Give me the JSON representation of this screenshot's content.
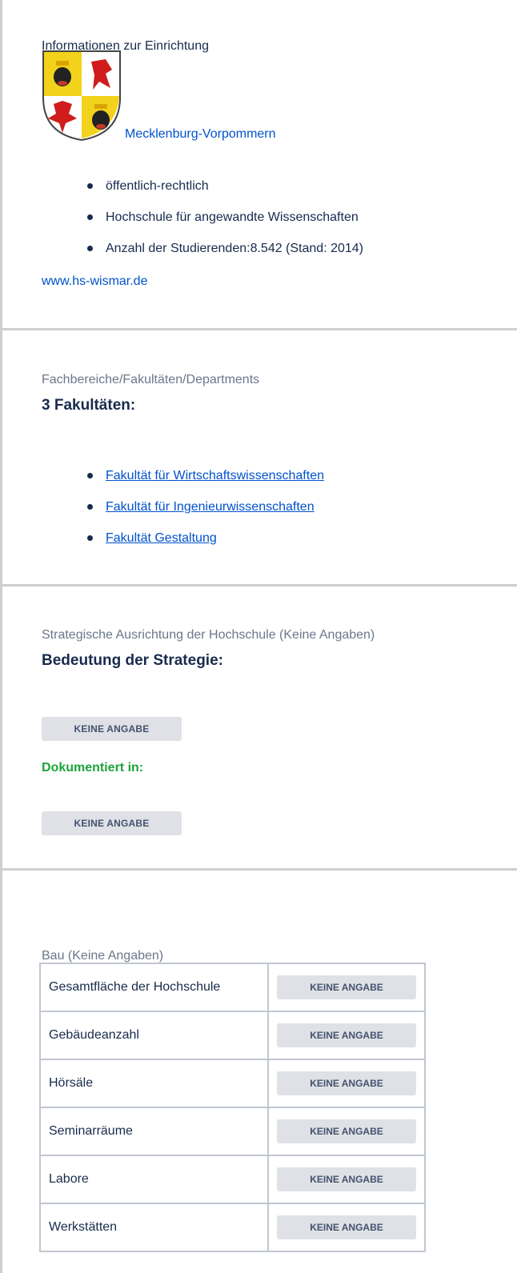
{
  "section1": {
    "title": "Informationen zur Einrichtung",
    "state_link": "Mecklenburg-Vorpommern",
    "coat_icon": "coat-of-arms-icon",
    "items": [
      "öffentlich-rechtlich",
      "Hochschule für angewandte Wissenschaften",
      "Anzahl der Studierenden:8.542 (Stand: 2014)"
    ],
    "website": "www.hs-wismar.de"
  },
  "section2": {
    "title": "Fachbereiche/Fakultäten/Departments",
    "heading": "3 Fakultäten:",
    "faculties": [
      "Fakultät für Wirtschaftswissenschaften",
      "Fakultät für Ingenieurwissenschaften",
      "Fakultät Gestaltung"
    ]
  },
  "section3": {
    "title": "Strategische Ausrichtung der Hochschule (Keine Angaben)",
    "heading": "Bedeutung der Strategie:",
    "value1": "KEINE ANGABE",
    "doc_label": "Dokumentiert in:",
    "value2": "KEINE ANGABE"
  },
  "section4": {
    "title": "Bau (Keine Angaben)",
    "rows": [
      {
        "label": "Gesamtfläche der Hochschule",
        "value": "KEINE ANGABE"
      },
      {
        "label": "Gebäudeanzahl",
        "value": "KEINE ANGABE"
      },
      {
        "label": "Hörsäle",
        "value": "KEINE ANGABE"
      },
      {
        "label": "Seminarräume",
        "value": "KEINE ANGABE"
      },
      {
        "label": "Labore",
        "value": "KEINE ANGABE"
      },
      {
        "label": "Werkstätten",
        "value": "KEINE ANGABE"
      }
    ]
  },
  "colors": {
    "link": "#0052cc",
    "green": "#1ea33a",
    "lozenge_bg": "#dfe1e6",
    "border": "#cfcfcf"
  }
}
